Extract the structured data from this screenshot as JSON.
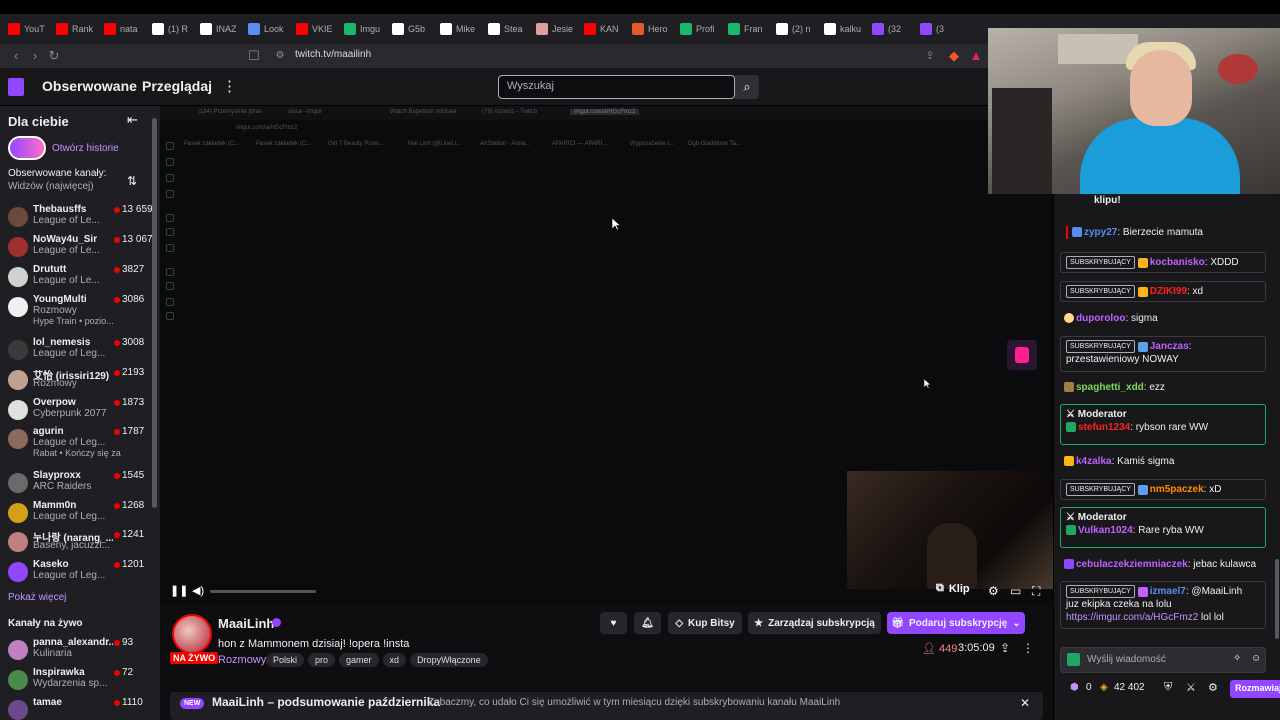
{
  "browser": {
    "tabs": [
      {
        "label": "YouT",
        "color": "#ff0000"
      },
      {
        "label": "Rank",
        "color": "#ff0000"
      },
      {
        "label": "nata",
        "color": "#ff0000"
      },
      {
        "label": "(1) R",
        "color": "#ffffff"
      },
      {
        "label": "INAZ",
        "color": "#ffffff"
      },
      {
        "label": "Look",
        "color": "#5a8dee"
      },
      {
        "label": "VKIE",
        "color": "#ff0000"
      },
      {
        "label": "Imgu",
        "color": "#1bb76e"
      },
      {
        "label": "G5b",
        "color": "#ffffff"
      },
      {
        "label": "Mike",
        "color": "#ffffff"
      },
      {
        "label": "Stea",
        "color": "#ffffff"
      },
      {
        "label": "Jesie",
        "color": "#e0a0a0"
      },
      {
        "label": "KAN",
        "color": "#ff0000"
      },
      {
        "label": "Hero",
        "color": "#e05a2a"
      },
      {
        "label": "Profi",
        "color": "#1bb76e"
      },
      {
        "label": "Fran",
        "color": "#1bb76e"
      },
      {
        "label": "(2) n",
        "color": "#ffffff"
      },
      {
        "label": "kalku",
        "color": "#ffffff"
      },
      {
        "label": "(32",
        "color": "#9147ff"
      },
      {
        "label": "(3",
        "color": "#9147ff"
      }
    ],
    "url": "twitch.tv/maailinh"
  },
  "topbar": {
    "nav_following": "Obserwowane",
    "nav_browse": "Przeglądaj",
    "search_placeholder": "Wyszukaj"
  },
  "sidebar": {
    "title": "Dla ciebie",
    "story_label": "Otwórz historie",
    "section_followed": "Obserwowane kanały:",
    "sort_label": "Widzów (najwięcej)",
    "channels": [
      {
        "name": "Thebausffs",
        "game": "League of Le...",
        "viewers": "13 659",
        "color": "#6a4a3a",
        "extra": ""
      },
      {
        "name": "NoWay4u_Sir",
        "game": "League of Le...",
        "viewers": "13 067",
        "color": "#a03030",
        "extra": ""
      },
      {
        "name": "Drututt",
        "game": "League of Le...",
        "viewers": "3827",
        "color": "#d0d0d0",
        "extra": ""
      },
      {
        "name": "YoungMulti",
        "game": "Rozmowy",
        "viewers": "3086",
        "color": "#f0f0f0",
        "extra": "Hype Train • pozio..."
      },
      {
        "name": "lol_nemesis",
        "game": "League of Leg...",
        "viewers": "3008",
        "color": "#3a3a3a",
        "extra": ""
      },
      {
        "name": "艾怡 (irissiri129)",
        "game": "Rozmowy",
        "viewers": "2193",
        "color": "#c0a090",
        "extra": ""
      },
      {
        "name": "Overpow",
        "game": "Cyberpunk 2077",
        "viewers": "1873",
        "color": "#e0e0e0",
        "extra": ""
      },
      {
        "name": "agurin",
        "game": "League of Leg...",
        "viewers": "1787",
        "color": "#8a6a5a",
        "extra": "Rabat • Kończy się za"
      },
      {
        "name": "Slayproxx",
        "game": "ARC Raiders",
        "viewers": "1545",
        "color": "#6a6a6a",
        "extra": ""
      },
      {
        "name": "Mamm0n",
        "game": "League of Leg...",
        "viewers": "1268",
        "color": "#d4a017",
        "extra": ""
      },
      {
        "name": "누나랑 (narang_...",
        "game": "Baseny, jacuzzi...",
        "viewers": "1241",
        "color": "#c08080",
        "extra": ""
      },
      {
        "name": "Kaseko",
        "game": "League of Leg...",
        "viewers": "1201",
        "color": "#9147ff",
        "extra": ""
      }
    ],
    "show_more": "Pokaż więcej",
    "section_live": "Kanały na żywo",
    "live_channels": [
      {
        "name": "panna_alexandr...",
        "game": "Kulinaria",
        "viewers": "93",
        "color": "#c080c0"
      },
      {
        "name": "Inspirawka",
        "game": "Wydarzenia sp...",
        "viewers": "72",
        "color": "#4a8a4a"
      },
      {
        "name": "tamae",
        "game": "",
        "viewers": "1110",
        "color": "#6a4a8a"
      }
    ]
  },
  "player": {
    "inner_tabs": [
      "(184) Przemyśmie (brav",
      "sissa - imgur",
      "Watch Bagettion michael",
      "(78) rozwod – Twitch",
      "imgur.com/a/HGcFmz2"
    ],
    "inner_url": "imgur.com/a/HGcFmz2",
    "inner_bookmarks": [
      "Pasek zakładek (C...",
      "Pasek zakładek (C...",
      "Girl 7 Beauty Pose...",
      "Mai Linh (@LiveLi...",
      "ArtStation - Anna...",
      "APARICI — APARI...",
      "Wyposażenie t...",
      "Dgb Gladstone Ta..."
    ],
    "clip_label": "Klip"
  },
  "stream": {
    "streamer": "MaaiLinh",
    "title": "hon z Mammonem dzisiaj! !opera !insta",
    "category": "Rozmowy",
    "tags": [
      "Polski",
      "pro",
      "gamer",
      "xd",
      "DropyWłączone"
    ],
    "live_label": "NA ŻYWO",
    "buy_bits": "Kup Bitsy",
    "manage_sub": "Zarządzaj subskrypcją",
    "gift_sub": "Podaruj subskrypcję",
    "viewers": "449",
    "uptime": "3:05:09",
    "banner_badge": "NEW",
    "banner_title": "MaaiLinh – podsumowanie października",
    "banner_text": "Zobaczmy, co udało Ci się umożliwić w tym miesiącu dzięki subskrybowaniu kanału MaaiLinh"
  },
  "chat": {
    "top_fragment": "klipu!",
    "sub_badge": "SUBSKRYBUJĄCY",
    "mod_label": "Moderator",
    "messages": [
      {
        "user": "zypy27",
        "text": ": Bierzecie mamuta",
        "color": "#5a8dee"
      },
      {
        "user": "kocbanisko",
        "text": ": XDDD",
        "color": "#c060ff"
      },
      {
        "user": "DZIKI99",
        "text": ": xd",
        "color": "#ff2020"
      },
      {
        "user": "duporoloo",
        "text": ": sigma",
        "color": "#c060ff"
      },
      {
        "user": "Janczas",
        "text": ":",
        "color": "#c060ff"
      },
      {
        "user": "spaghetti_xdd",
        "text": ": ezz",
        "color": "#7ed957"
      },
      {
        "user": "stefun1234",
        "text": ": rybson rare WW",
        "color": "#ff2020"
      },
      {
        "user": "k4zalka",
        "text": ": Kamiś sigma",
        "color": "#c060ff"
      },
      {
        "user": "nm5paczek",
        "text": ": xD",
        "color": "#ff8c00"
      },
      {
        "user": "Vulkan1024",
        "text": ": Rare ryba WW",
        "color": "#c060ff"
      },
      {
        "user": "cebulaczekziemniaczek",
        "text": ": jebac kulawca",
        "color": "#c060ff"
      },
      {
        "user": "izmael7",
        "text": ": @MaaiLinh",
        "color": "#5a8dee"
      }
    ],
    "janczas_line2": "przestawieniowy NOWAY",
    "izmael_line2": "juz ekipka czeka na lolu",
    "izmael_link": "https://imgur.com/a/HGcFmz2",
    "izmael_tail": " lol lol",
    "input_placeholder": "Wyślij wiadomość",
    "points": "0",
    "bits": "42 402",
    "send_label": "Rozmawiaj"
  }
}
